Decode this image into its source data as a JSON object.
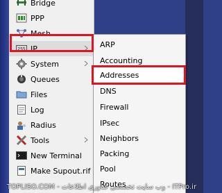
{
  "main_menu": {
    "items": [
      {
        "label": "Bridge",
        "icon": "bridge-icon"
      },
      {
        "label": "PPP",
        "icon": "ppp-icon"
      },
      {
        "label": "Mesh",
        "icon": "mesh-icon"
      },
      {
        "label": "IP",
        "icon": "ip-icon",
        "has_submenu": true,
        "highlighted": true
      },
      {
        "label": "System",
        "icon": "gear-icon",
        "has_submenu": true
      },
      {
        "label": "Queues",
        "icon": "queues-icon"
      },
      {
        "label": "Files",
        "icon": "folder-icon"
      },
      {
        "label": "Log",
        "icon": "log-icon"
      },
      {
        "label": "Radius",
        "icon": "radius-icon"
      },
      {
        "label": "Tools",
        "icon": "tools-icon",
        "has_submenu": true
      },
      {
        "label": "New Terminal",
        "icon": "terminal-icon"
      },
      {
        "label": "Make Supout.rif",
        "icon": "supout-icon"
      }
    ]
  },
  "ip_submenu": {
    "items": [
      {
        "label": "ARP"
      },
      {
        "label": "Accounting"
      },
      {
        "label": "Addresses",
        "highlighted": true
      },
      {
        "label": "DNS"
      },
      {
        "label": "Firewall"
      },
      {
        "label": "IPsec"
      },
      {
        "label": "Neighbors"
      },
      {
        "label": "Packing"
      },
      {
        "label": "Pool"
      },
      {
        "label": "Routes"
      }
    ]
  },
  "watermark": "TOPLISO.COM - وب سایت تخصصی فناوری اطلاعات - ITPro.ir",
  "colors": {
    "highlight_red": "#e0131e",
    "menu_background": "#f0f0f0",
    "side_strip_blue": "#2f3f88"
  }
}
